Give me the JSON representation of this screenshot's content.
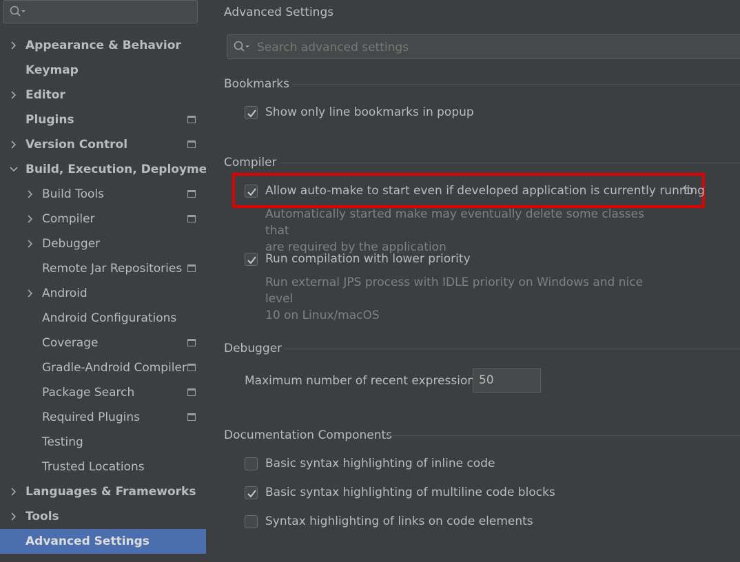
{
  "sidebar": {
    "search": {
      "value": ""
    },
    "items": [
      {
        "label": "Appearance & Behavior",
        "level": 0,
        "arrow": "right",
        "project": false
      },
      {
        "label": "Keymap",
        "level": 0,
        "arrow": "none",
        "project": false
      },
      {
        "label": "Editor",
        "level": 0,
        "arrow": "right",
        "project": false
      },
      {
        "label": "Plugins",
        "level": 0,
        "arrow": "none",
        "project": true
      },
      {
        "label": "Version Control",
        "level": 0,
        "arrow": "right",
        "project": true
      },
      {
        "label": "Build, Execution, Deployment",
        "level": 0,
        "arrow": "down",
        "project": false
      },
      {
        "label": "Build Tools",
        "level": 1,
        "arrow": "right",
        "project": true
      },
      {
        "label": "Compiler",
        "level": 1,
        "arrow": "right",
        "project": true
      },
      {
        "label": "Debugger",
        "level": 1,
        "arrow": "right",
        "project": false
      },
      {
        "label": "Remote Jar Repositories",
        "level": 1,
        "arrow": "none",
        "project": true
      },
      {
        "label": "Android",
        "level": 1,
        "arrow": "right",
        "project": false
      },
      {
        "label": "Android Configurations",
        "level": 1,
        "arrow": "none",
        "project": false
      },
      {
        "label": "Coverage",
        "level": 1,
        "arrow": "none",
        "project": true
      },
      {
        "label": "Gradle-Android Compiler",
        "level": 1,
        "arrow": "none",
        "project": true
      },
      {
        "label": "Package Search",
        "level": 1,
        "arrow": "none",
        "project": true
      },
      {
        "label": "Required Plugins",
        "level": 1,
        "arrow": "none",
        "project": true
      },
      {
        "label": "Testing",
        "level": 1,
        "arrow": "none",
        "project": false
      },
      {
        "label": "Trusted Locations",
        "level": 1,
        "arrow": "none",
        "project": false
      },
      {
        "label": "Languages & Frameworks",
        "level": 0,
        "arrow": "right",
        "project": false
      },
      {
        "label": "Tools",
        "level": 0,
        "arrow": "right",
        "project": false
      },
      {
        "label": "Advanced Settings",
        "level": 0,
        "arrow": "none",
        "project": false,
        "selected": true
      }
    ]
  },
  "main": {
    "title": "Advanced Settings",
    "search": {
      "placeholder": "Search advanced settings"
    },
    "bookmarks": {
      "header": "Bookmarks",
      "option1": {
        "label": "Show only line bookmarks in popup",
        "checked": true
      }
    },
    "compiler": {
      "header": "Compiler",
      "option1": {
        "label": "Allow auto-make to start even if developed application is currently running",
        "checked": true,
        "desc_line1": "Automatically started make may eventually delete some classes that",
        "desc_line2": "are required by the application"
      },
      "option2": {
        "label": "Run compilation with lower priority",
        "checked": true,
        "desc_line1": "Run external JPS process with IDLE priority on Windows and nice level",
        "desc_line2": "10 on Linux/macOS"
      }
    },
    "debugger": {
      "header": "Debugger",
      "recent_label": "Maximum number of recent expressions:",
      "recent_value": "50"
    },
    "documentation": {
      "header": "Documentation Components",
      "option1": {
        "label": "Basic syntax highlighting of inline code",
        "checked": false
      },
      "option2": {
        "label": "Basic syntax highlighting of multiline code blocks",
        "checked": true
      },
      "option3": {
        "label": "Syntax highlighting of links on code elements",
        "checked": false
      }
    }
  },
  "colors": {
    "background": "#3c3f41",
    "selection": "#4b6eaf",
    "highlight": "#e00000",
    "text": "#bbbbbb",
    "muted_text": "#808080"
  },
  "icons": {
    "search": "search-icon",
    "arrow_right": "chevron-right-icon",
    "arrow_down": "chevron-down-icon",
    "project": "project-level-icon",
    "check": "checkmark-icon",
    "reset": "reset-icon"
  }
}
